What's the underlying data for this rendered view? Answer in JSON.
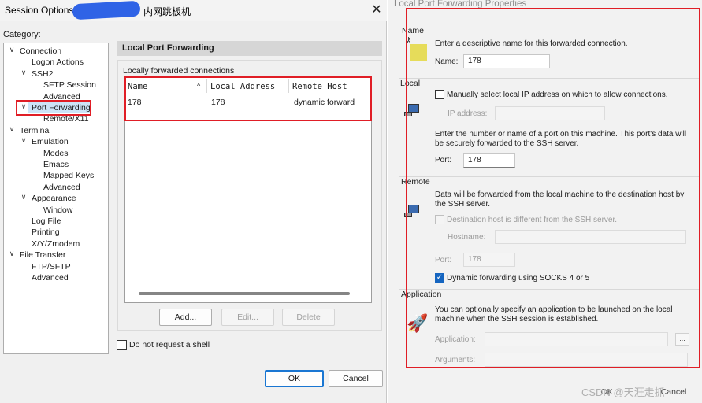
{
  "session_options": {
    "title": "Session Options",
    "title_suffix": "内网跳板机",
    "category_label": "Category:",
    "tree": [
      {
        "label": "Connection",
        "level": 0,
        "expanded": true
      },
      {
        "label": "Logon Actions",
        "level": 1
      },
      {
        "label": "SSH2",
        "level": 1,
        "expanded": true
      },
      {
        "label": "SFTP Session",
        "level": 2
      },
      {
        "label": "Advanced",
        "level": 2
      },
      {
        "label": "Port Forwarding",
        "level": 1,
        "expanded": true,
        "selected": true
      },
      {
        "label": "Remote/X11",
        "level": 2
      },
      {
        "label": "Terminal",
        "level": 0,
        "expanded": true
      },
      {
        "label": "Emulation",
        "level": 1,
        "expanded": true
      },
      {
        "label": "Modes",
        "level": 2
      },
      {
        "label": "Emacs",
        "level": 2
      },
      {
        "label": "Mapped Keys",
        "level": 2
      },
      {
        "label": "Advanced",
        "level": 2
      },
      {
        "label": "Appearance",
        "level": 1,
        "expanded": true
      },
      {
        "label": "Window",
        "level": 2
      },
      {
        "label": "Log File",
        "level": 1
      },
      {
        "label": "Printing",
        "level": 1
      },
      {
        "label": "X/Y/Zmodem",
        "level": 1
      },
      {
        "label": "File Transfer",
        "level": 0,
        "expanded": true
      },
      {
        "label": "FTP/SFTP",
        "level": 1
      },
      {
        "label": "Advanced",
        "level": 1
      }
    ],
    "panel_title": "Local Port Forwarding",
    "forwarded_label": "Locally forwarded connections",
    "columns": [
      "Name",
      "Local Address",
      "Remote Host"
    ],
    "rows": [
      {
        "name": "178",
        "local": "178",
        "remote": "dynamic forward"
      }
    ],
    "buttons": {
      "add": "Add...",
      "edit": "Edit...",
      "delete": "Delete"
    },
    "no_shell_label": "Do not request a shell",
    "ok": "OK",
    "cancel": "Cancel"
  },
  "lpf_properties": {
    "title": "Local Port Forwarding Properties",
    "name_section": {
      "label": "Name",
      "desc": "Enter a descriptive name for this forwarded connection.",
      "field_label": "Name:",
      "value": "178"
    },
    "local_section": {
      "label": "Local",
      "manual_ip_label": "Manually select local IP address on which to allow connections.",
      "ip_label": "IP address:",
      "port_desc": "Enter the number or name of a port on this machine.  This port's data will be securely forwarded to the SSH server.",
      "port_label": "Port:",
      "port_value": "178"
    },
    "remote_section": {
      "label": "Remote",
      "desc": "Data will be forwarded from the local machine to the destination host by the SSH server.",
      "dest_diff_label": "Destination host is different from the SSH server.",
      "hostname_label": "Hostname:",
      "port_label": "Port:",
      "port_value": "178",
      "dynamic_label": "Dynamic forwarding using SOCKS 4 or 5"
    },
    "application_section": {
      "label": "Application",
      "desc": "You can optionally specify an application to be launched on the local machine when the SSH session is established.",
      "application_label": "Application:",
      "arguments_label": "Arguments:",
      "browse": "..."
    },
    "ok": "OK",
    "cancel": "Cancel"
  },
  "watermark": "CSDN @天涯走抓"
}
